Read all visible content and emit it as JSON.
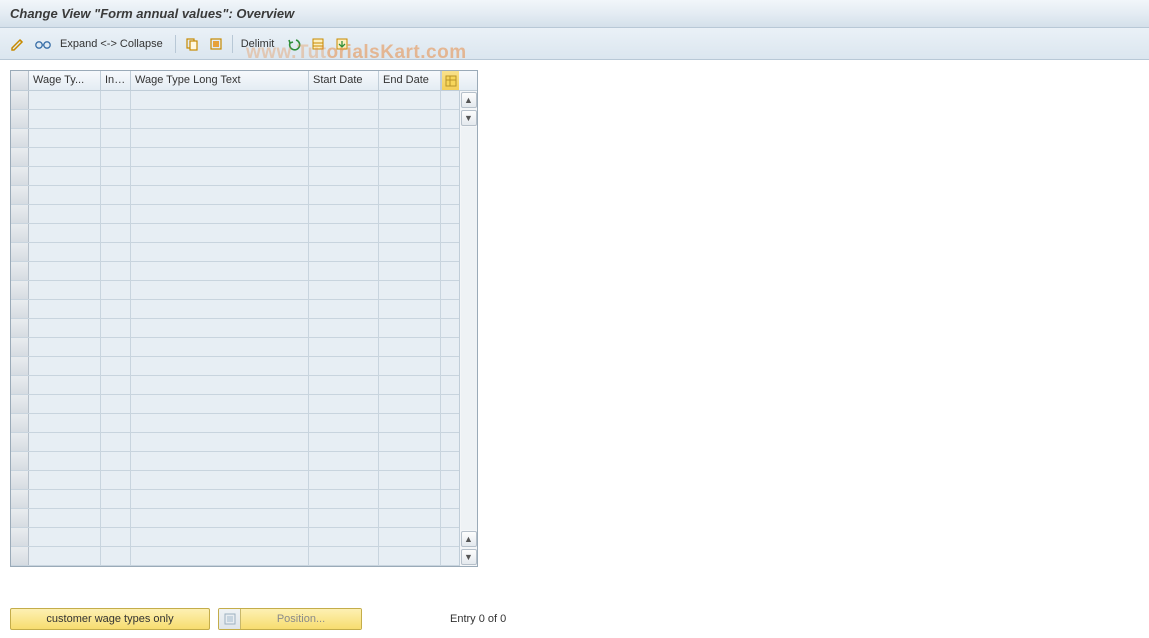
{
  "title": "Change View \"Form annual values\": Overview",
  "toolbar": {
    "expand_collapse": "Expand <-> Collapse",
    "delimit": "Delimit"
  },
  "table": {
    "columns": {
      "wage_ty": "Wage Ty...",
      "inf": "Inf...",
      "long_text": "Wage Type Long Text",
      "start_date": "Start Date",
      "end_date": "End Date"
    },
    "row_count": 25
  },
  "footer": {
    "customer_button": "customer wage types only",
    "position_label": "Position...",
    "entry_status": "Entry 0 of 0"
  },
  "watermark": "www.TutorialsKart.com"
}
